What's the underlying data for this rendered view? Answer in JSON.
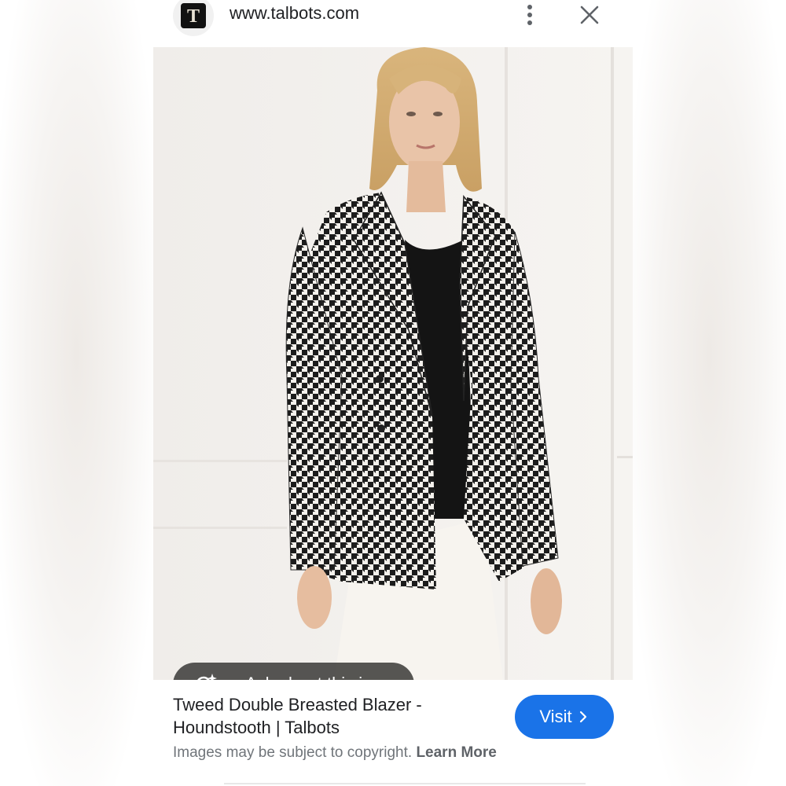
{
  "header": {
    "favicon_letter": "T",
    "domain": "www.talbots.com"
  },
  "image": {
    "ask_label": "Ask about this image"
  },
  "result": {
    "title_line1": "Tweed Double Breasted Blazer -",
    "title_line2": "Houndstooth | Talbots",
    "copyright_text": "Images may be subject to copyright.",
    "learn_more": "Learn More",
    "visit_label": "Visit"
  },
  "colors": {
    "accent": "#1a73e8",
    "pill": "#484644"
  },
  "icons": [
    "more-vert-icon",
    "close-icon",
    "lens-sparkle-icon",
    "chevron-right-icon"
  ]
}
